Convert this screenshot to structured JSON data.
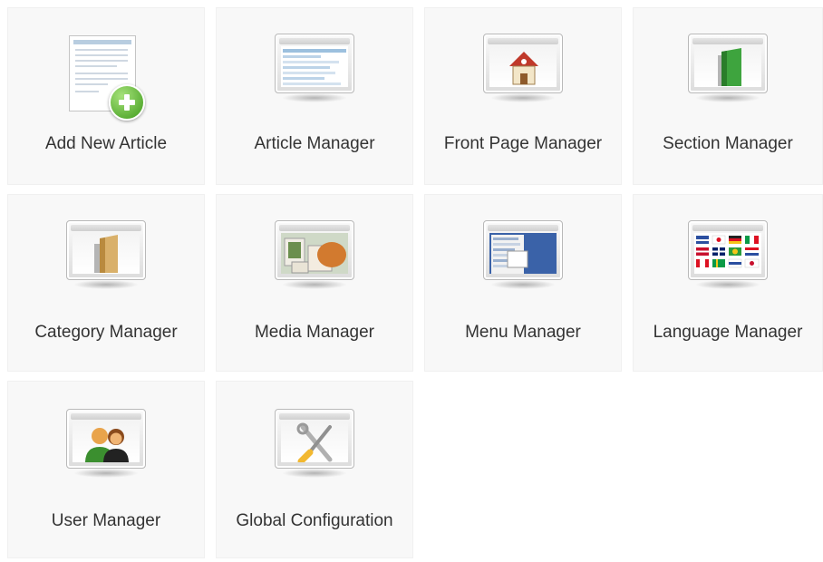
{
  "tiles": [
    {
      "label": "Add New Article",
      "icon": "add-article-icon"
    },
    {
      "label": "Article Manager",
      "icon": "article-manager-icon"
    },
    {
      "label": "Front Page Manager",
      "icon": "home-icon"
    },
    {
      "label": "Section Manager",
      "icon": "section-folder-icon"
    },
    {
      "label": "Category Manager",
      "icon": "category-folder-icon"
    },
    {
      "label": "Media Manager",
      "icon": "media-icon"
    },
    {
      "label": "Menu Manager",
      "icon": "menu-icon"
    },
    {
      "label": "Language Manager",
      "icon": "flags-icon"
    },
    {
      "label": "User Manager",
      "icon": "users-icon"
    },
    {
      "label": "Global Configuration",
      "icon": "tools-icon"
    }
  ]
}
